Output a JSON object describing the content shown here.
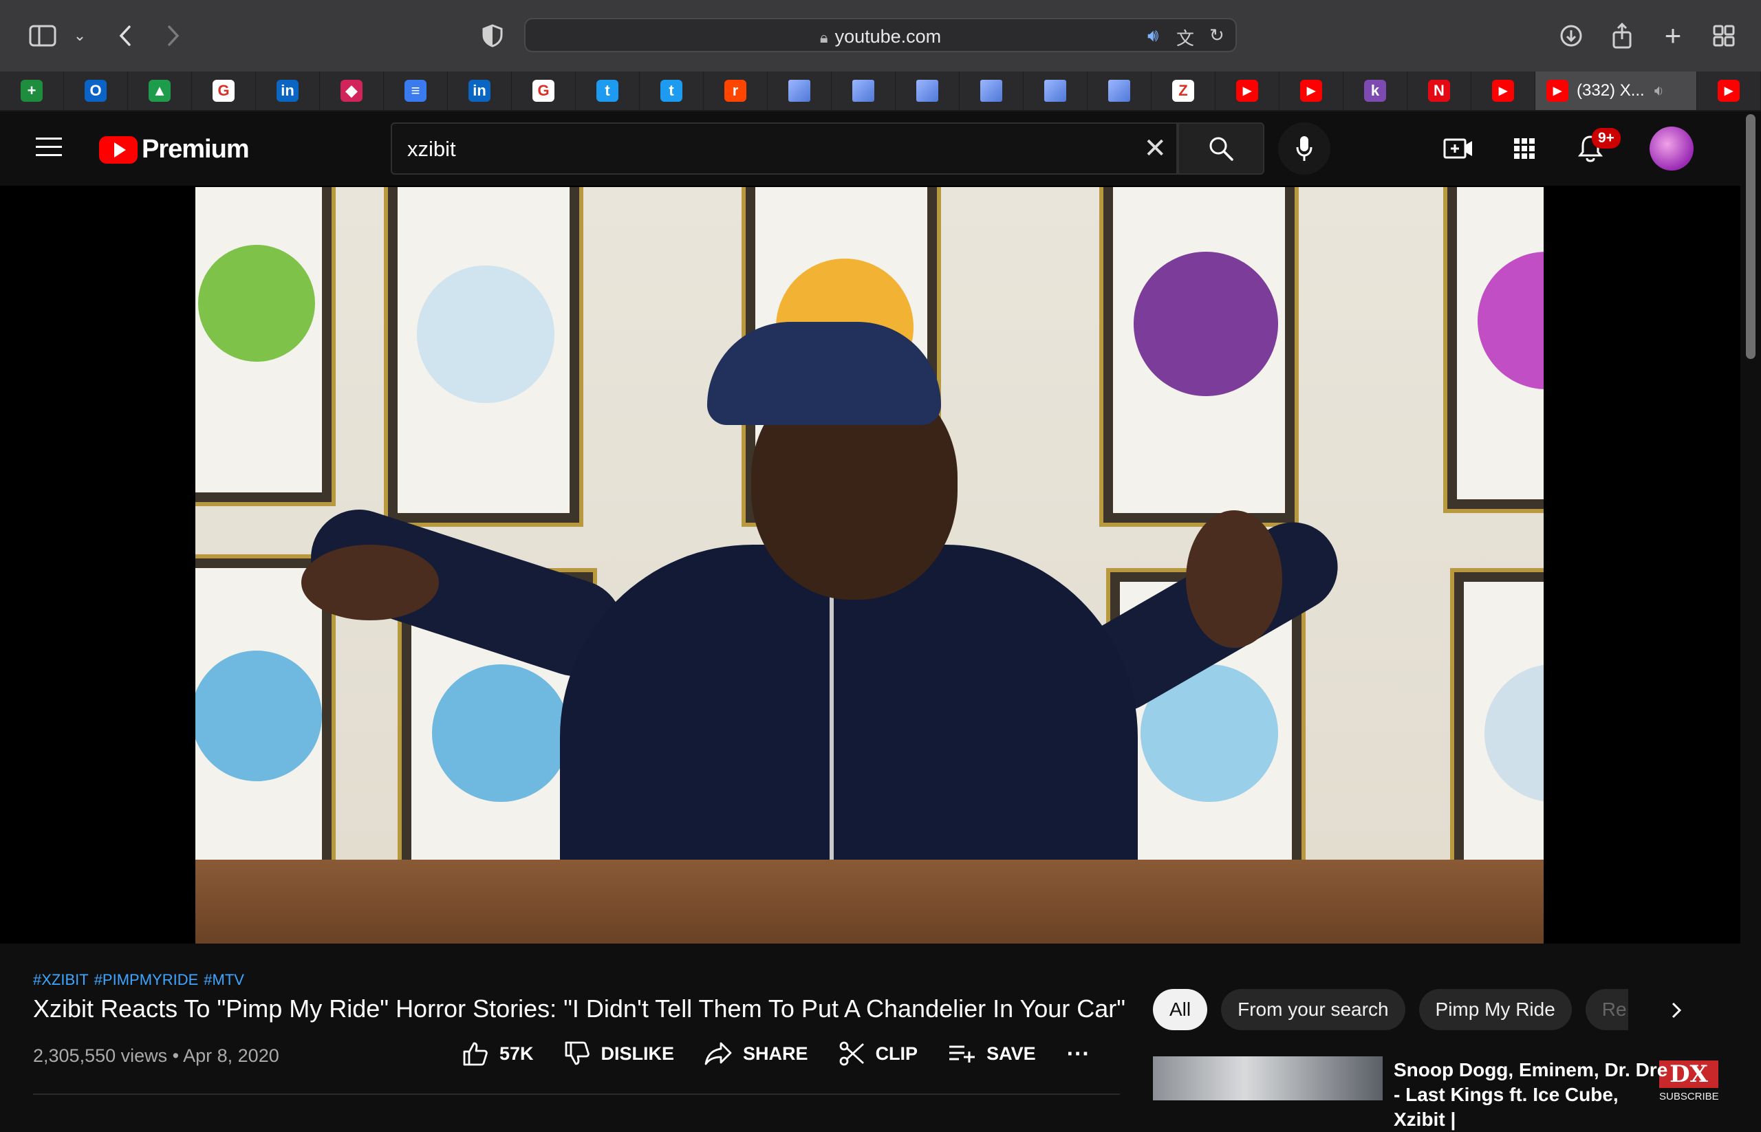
{
  "browser": {
    "url": "youtube.com",
    "active_tab_label": "(332) X..."
  },
  "tabs": [
    {
      "icon": "google-sheets-icon",
      "glyph": "+",
      "color": "#1e8e3e"
    },
    {
      "icon": "outlook-icon",
      "glyph": "O",
      "color": "#0a64c8"
    },
    {
      "icon": "google-classroom-icon",
      "glyph": "▲",
      "color": "#1f9b4c"
    },
    {
      "icon": "google-icon",
      "glyph": "G",
      "color": "#ffffff"
    },
    {
      "icon": "linkedin-icon",
      "glyph": "in",
      "color": "#0a66c2"
    },
    {
      "icon": "bookmark-app-icon",
      "glyph": "◆",
      "color": "#d0245a"
    },
    {
      "icon": "google-docs-icon",
      "glyph": "≡",
      "color": "#3b7bf0"
    },
    {
      "icon": "linkedin-icon",
      "glyph": "in",
      "color": "#0a66c2"
    },
    {
      "icon": "google-icon",
      "glyph": "G",
      "color": "#ffffff"
    },
    {
      "icon": "twitter-icon",
      "glyph": "t",
      "color": "#1d9bf0"
    },
    {
      "icon": "twitter-icon",
      "glyph": "t",
      "color": "#1d9bf0"
    },
    {
      "icon": "reddit-icon",
      "glyph": "r",
      "color": "#ff4500"
    },
    {
      "icon": "generic-page-icon",
      "glyph": "",
      "color": "#4f78d8"
    },
    {
      "icon": "generic-page-icon",
      "glyph": "",
      "color": "#4f78d8"
    },
    {
      "icon": "generic-page-icon",
      "glyph": "",
      "color": "#4f78d8"
    },
    {
      "icon": "generic-page-icon",
      "glyph": "",
      "color": "#4f78d8"
    },
    {
      "icon": "generic-page-icon",
      "glyph": "",
      "color": "#4f78d8"
    },
    {
      "icon": "generic-page-icon",
      "glyph": "",
      "color": "#4f78d8"
    },
    {
      "icon": "zotero-icon",
      "glyph": "Z",
      "color": "#ffffff"
    },
    {
      "icon": "youtube-icon",
      "glyph": "▶",
      "color": "#ff0000"
    },
    {
      "icon": "youtube-icon",
      "glyph": "▶",
      "color": "#ff0000"
    },
    {
      "icon": "app-icon",
      "glyph": "k",
      "color": "#7c4ab0"
    },
    {
      "icon": "netflix-icon",
      "glyph": "N",
      "color": "#e50914"
    },
    {
      "icon": "youtube-icon",
      "glyph": "▶",
      "color": "#ff0000"
    }
  ],
  "youtube": {
    "logo_text": "Premium",
    "search_value": "xzibit",
    "notification_count": "9+"
  },
  "video": {
    "channel_watermark": "DX",
    "channel_watermark_sub": "SUBSCRIBE"
  },
  "below": {
    "hashtags": [
      "#XZIBIT",
      "#PIMPMYRIDE",
      "#MTV"
    ],
    "title": "Xzibit Reacts To \"Pimp My Ride\" Horror Stories: \"I Didn't Tell Them To Put A Chandelier In Your Car\"",
    "views": "2,305,550 views",
    "separator": "•",
    "date": "Apr 8, 2020",
    "actions": {
      "like": "57K",
      "dislike": "DISLIKE",
      "share": "SHARE",
      "clip": "CLIP",
      "save": "SAVE"
    }
  },
  "chips": {
    "all": "All",
    "from_search": "From your search",
    "pimp": "Pimp My Ride",
    "cut": "Re"
  },
  "recommendation": {
    "title": "Snoop Dogg, Eminem, Dr. Dre - Last Kings ft. Ice Cube, Xzibit |"
  },
  "colors": {
    "accent_red": "#ff0000",
    "link_blue": "#3ea6ff",
    "bg": "#0f0f0f"
  }
}
